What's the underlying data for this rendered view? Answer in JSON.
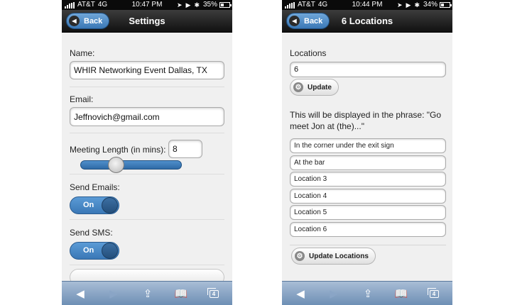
{
  "left": {
    "status": {
      "carrier": "AT&T",
      "network": "4G",
      "time": "10:47 PM",
      "battery": "35%",
      "battery_level": 0.35
    },
    "header": {
      "back_label": "Back",
      "title": "Settings"
    },
    "form": {
      "name_label": "Name:",
      "name_value": "WHIR Networking Event Dallas, TX",
      "email_label": "Email:",
      "email_value": "Jeffnovich@gmail.com",
      "meeting_label": "Meeting Length (in mins):",
      "meeting_value": "8",
      "meeting_slider_fraction": 0.35,
      "send_emails_label": "Send Emails:",
      "send_emails_state": "On",
      "send_sms_label": "Send SMS:",
      "send_sms_state": "On"
    }
  },
  "right": {
    "status": {
      "carrier": "AT&T",
      "network": "4G",
      "time": "10:44 PM",
      "battery": "34%",
      "battery_level": 0.34
    },
    "header": {
      "back_label": "Back",
      "title": "6 Locations"
    },
    "form": {
      "locations_label": "Locations",
      "locations_value": "6",
      "update_label": "Update",
      "phrase_text": "This will be displayed in the phrase: \"Go meet Jon at (the)...\"",
      "locations": [
        "In the corner under the exit sign",
        "At the bar",
        "Location 3",
        "Location 4",
        "Location 5",
        "Location 6"
      ],
      "update_locations_label": "Update Locations"
    }
  },
  "toolbar": {
    "tabs_count": "4"
  },
  "colors": {
    "accent": "#3a78b6",
    "header_dark": "#111111",
    "toolbar": "#6e8fb5"
  }
}
